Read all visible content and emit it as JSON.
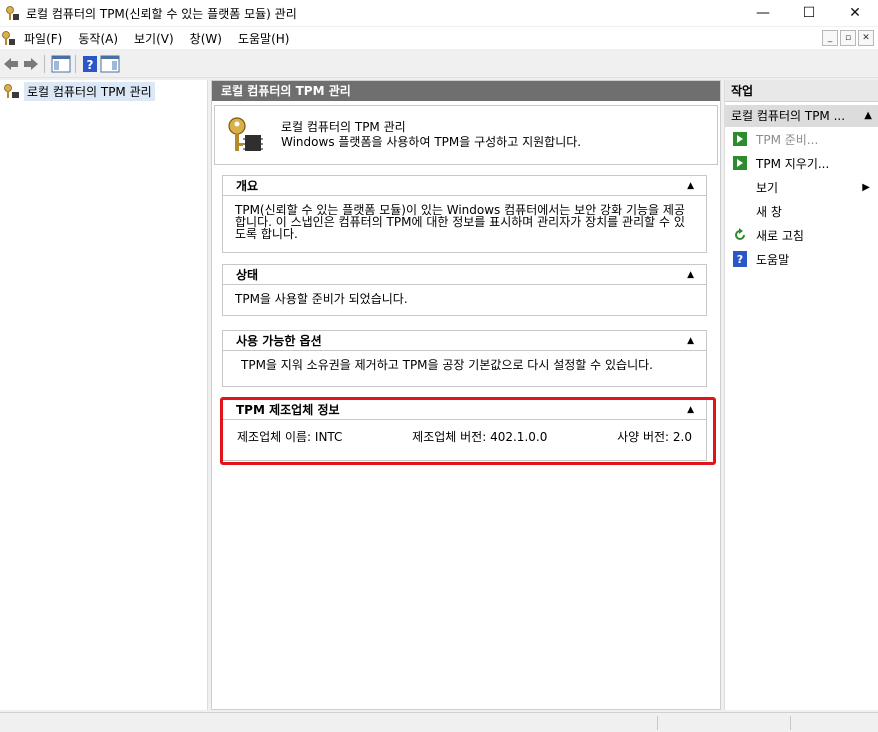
{
  "window": {
    "title": "로컬 컴퓨터의 TPM(신뢰할 수 있는 플랫폼 모듈) 관리",
    "minimize": "—",
    "maximize": "☐",
    "close": "✕"
  },
  "menu": [
    "파일(F)",
    "동작(A)",
    "보기(V)",
    "창(W)",
    "도움말(H)"
  ],
  "tree": {
    "root_label": "로컬 컴퓨터의 TPM 관리"
  },
  "center": {
    "header": "로컬 컴퓨터의 TPM 관리",
    "info_title": "로컬 컴퓨터의 TPM 관리",
    "info_desc": "Windows 플랫폼을 사용하여 TPM을 구성하고 지원합니다.",
    "overview": {
      "title": "개요",
      "body": "TPM(신뢰할 수 있는 플랫폼 모듈)이 있는 Windows 컴퓨터에서는 보안 강화 기능을 제공합니다. 이 스냅인은 컴퓨터의 TPM에 대한 정보를 표시하며 관리자가 장치를 관리할 수 있도록 합니다."
    },
    "status": {
      "title": "상태",
      "body": "TPM을 사용할 준비가 되었습니다."
    },
    "options": {
      "title": "사용 가능한 옵션",
      "body": "TPM을 지워 소유권을 제거하고 TPM을 공장 기본값으로 다시 설정할 수 있습니다."
    },
    "manufacturer": {
      "title": "TPM 제조업체 정보",
      "name": "제조업체 이름: INTC",
      "version": "제조업체 버전: 402.1.0.0",
      "spec": "사양 버전: 2.0"
    }
  },
  "actions": {
    "header": "작업",
    "group": "로컬 컴퓨터의 TPM ...",
    "items": [
      {
        "label": "TPM 준비...",
        "icon": "green-arrow-icon",
        "disabled": true
      },
      {
        "label": "TPM 지우기...",
        "icon": "green-arrow-icon",
        "disabled": false
      },
      {
        "label": "보기",
        "icon": "none",
        "disabled": false
      },
      {
        "label": "새 창",
        "icon": "none",
        "disabled": false
      },
      {
        "label": "새로 고침",
        "icon": "refresh-icon",
        "disabled": false
      },
      {
        "label": "도움말",
        "icon": "help-icon",
        "disabled": false
      }
    ]
  },
  "colors": {
    "highlight": "#e2121b",
    "header_bg": "#6f6f6f",
    "selected": "#dde8f6"
  }
}
